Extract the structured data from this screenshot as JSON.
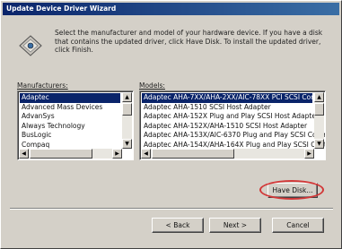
{
  "window": {
    "title": "Update Device Driver Wizard"
  },
  "instruction": "Select the manufacturer and model of your hardware device. If you have a disk that contains the updated driver, click Have Disk. To install the updated driver, click Finish.",
  "manufacturers": {
    "label": "Manufacturers:",
    "items": [
      {
        "label": "Adaptec",
        "selected": true
      },
      {
        "label": "Advanced Mass Devices",
        "selected": false
      },
      {
        "label": "AdvanSys",
        "selected": false
      },
      {
        "label": "Always Technology",
        "selected": false
      },
      {
        "label": "BusLogic",
        "selected": false
      },
      {
        "label": "Compaq",
        "selected": false
      }
    ]
  },
  "models": {
    "label": "Models:",
    "items": [
      {
        "label": "Adaptec AHA-7XX/AHA-2XX/AIC-78XX PCI SCSI Controller",
        "selected": true
      },
      {
        "label": "Adaptec AHA-1510 SCSI Host Adapter",
        "selected": false
      },
      {
        "label": "Adaptec AHA-152X Plug and Play SCSI Host Adapter",
        "selected": false
      },
      {
        "label": "Adaptec AHA-152X/AHA-1510 SCSI Host Adapter",
        "selected": false
      },
      {
        "label": "Adaptec AHA-153X/AIC-6370 Plug and Play SCSI Controller",
        "selected": false
      },
      {
        "label": "Adaptec AHA-154X/AHA-164X Plug and Play SCSI Controller",
        "selected": false
      }
    ]
  },
  "buttons": {
    "have_disk": "Have Disk...",
    "back": "< Back",
    "next": "Next >",
    "cancel": "Cancel"
  },
  "colors": {
    "title_bar_start": "#0a246a",
    "title_bar_end": "#3a6ea5",
    "selection": "#0a246a",
    "dialog_face": "#d4d0c8",
    "annotation_ellipse": "#d23838"
  },
  "icons": {
    "wizard": "driver-disk-icon"
  }
}
